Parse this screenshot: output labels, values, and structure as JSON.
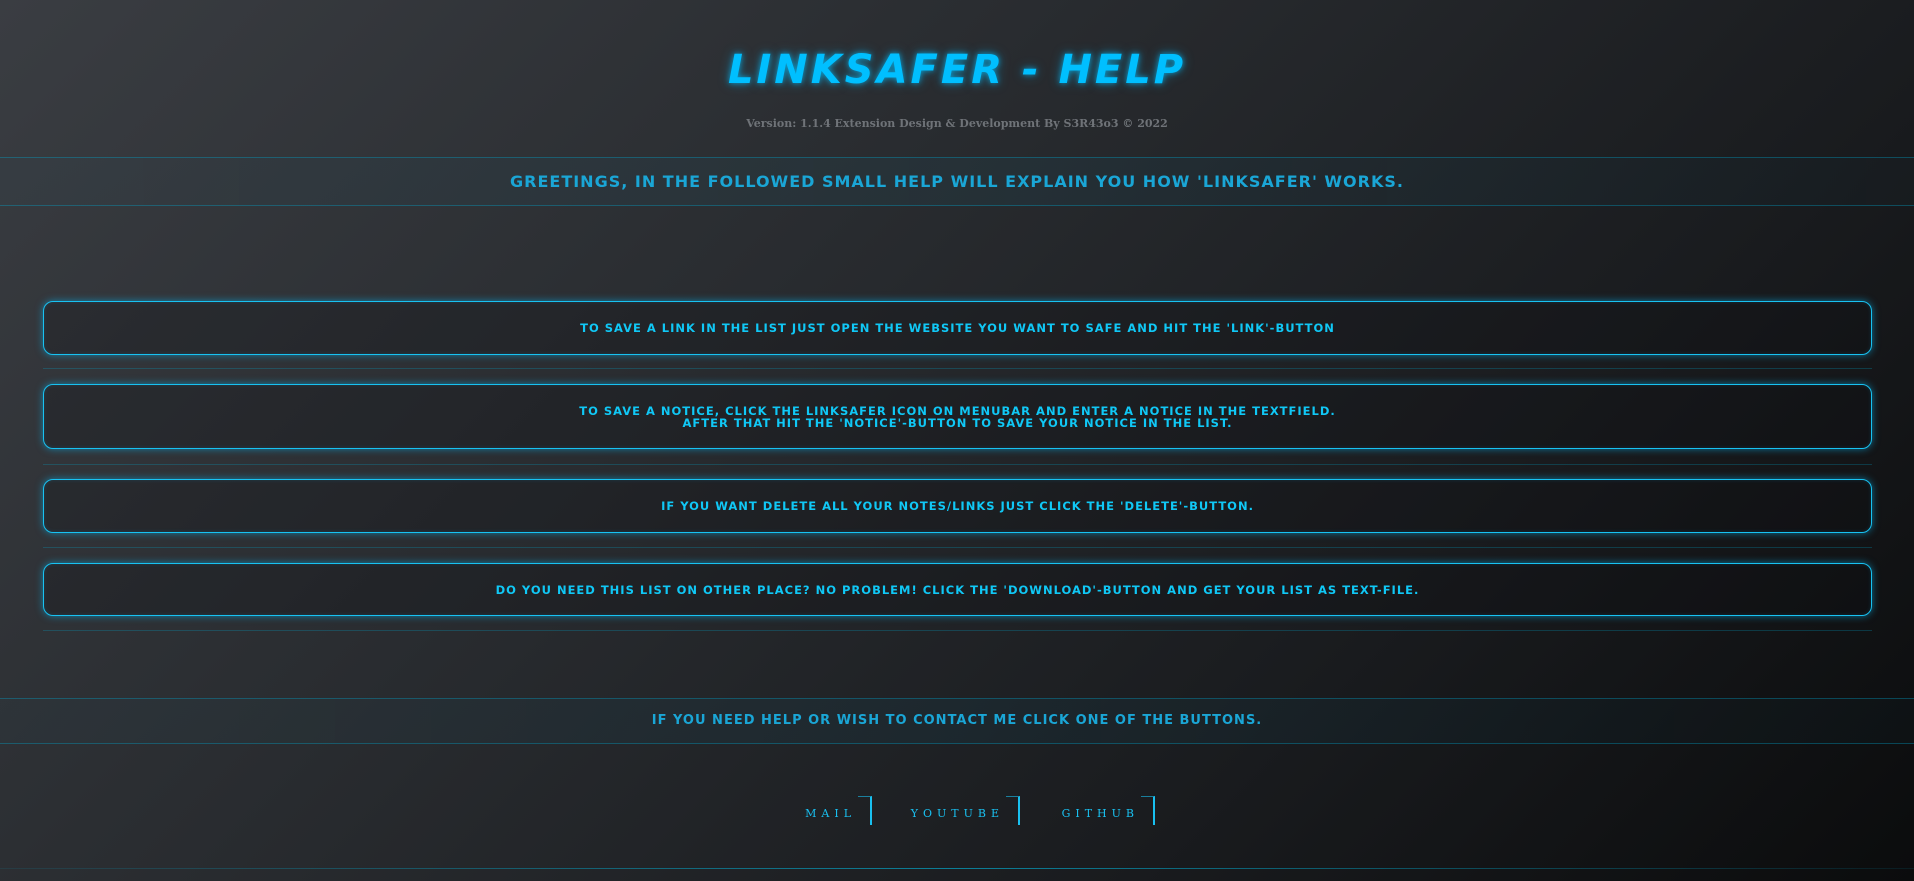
{
  "header": {
    "title": "LINKSAFER - HELP",
    "version": "Version: 1.1.4 Extension Design & Development By S3R43o3 © 2022"
  },
  "greeting": "GREETINGS, IN THE FOLLOWED SMALL HELP WILL EXPLAIN YOU HOW 'LINKSAFER' WORKS.",
  "help_items": [
    {
      "line1": "TO SAVE A LINK IN THE LIST JUST OPEN THE WEBSITE YOU WANT TO SAFE AND HIT THE 'LINK'-BUTTON",
      "line2": ""
    },
    {
      "line1": "TO SAVE A NOTICE, CLICK THE LINKSAFER ICON ON MENUBAR AND ENTER A NOTICE IN THE TEXTFIELD.",
      "line2": "AFTER THAT HIT THE 'NOTICE'-BUTTON TO SAVE YOUR NOTICE IN THE LIST."
    },
    {
      "line1": "IF YOU WANT DELETE ALL YOUR NOTES/LINKS JUST CLICK THE 'DELETE'-BUTTON.",
      "line2": ""
    },
    {
      "line1": "DO YOU NEED THIS LIST ON OTHER PLACE? NO PROBLEM! CLICK THE 'DOWNLOAD'-BUTTON AND GET YOUR LIST AS TEXT-FILE.",
      "line2": ""
    }
  ],
  "contact_text": "IF YOU NEED HELP OR WISH TO CONTACT ME CLICK ONE OF THE BUTTONS.",
  "contact_links": {
    "mail": "MAIL",
    "youtube": "YOUTUBE",
    "github": "GITHUB"
  },
  "colors": {
    "accent": "#00bfff",
    "card_text": "#10c8f6",
    "band_text": "#1aa6d6",
    "version_text": "#6f7378"
  }
}
